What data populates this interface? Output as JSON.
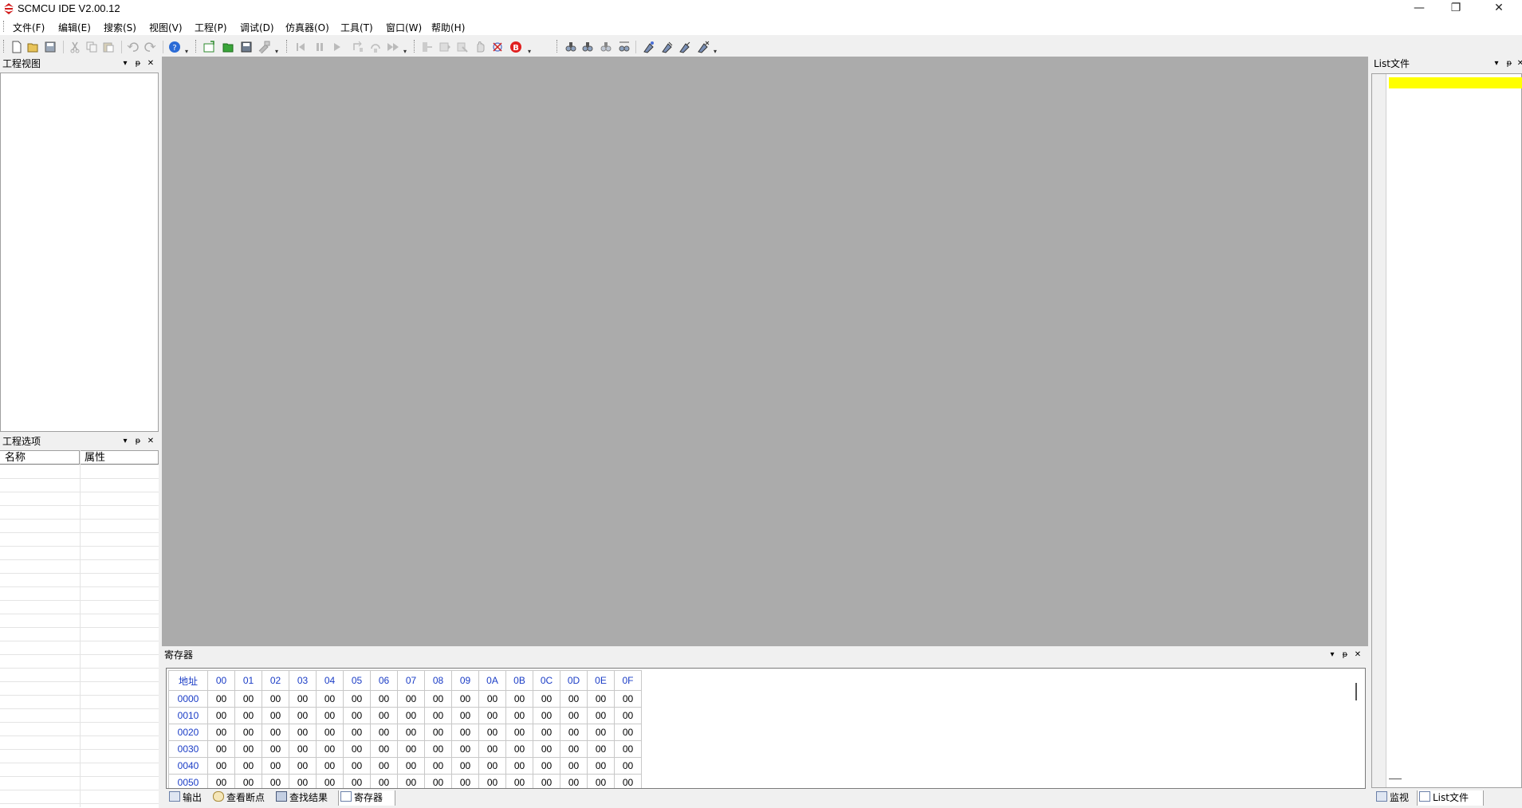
{
  "window": {
    "title": "SCMCU IDE V2.00.12",
    "minimize_glyph": "—",
    "restore_glyph": "❐",
    "close_glyph": "✕"
  },
  "menu": [
    {
      "label": "文件(F)"
    },
    {
      "label": "编辑(E)"
    },
    {
      "label": "搜索(S)"
    },
    {
      "label": "视图(V)"
    },
    {
      "label": "工程(P)"
    },
    {
      "label": "调试(D)"
    },
    {
      "label": "仿真器(O)"
    },
    {
      "label": "工具(T)"
    },
    {
      "label": "窗口(W)"
    },
    {
      "label": "帮助(H)"
    }
  ],
  "toolbar_icons": [
    "new-file-icon",
    "open-file-icon",
    "save-icon",
    "cut-icon",
    "copy-icon",
    "paste-icon",
    "undo-icon",
    "redo-icon",
    "help-icon",
    "new-project-icon",
    "open-project-icon",
    "save-project-icon",
    "build-icon",
    "reset-icon",
    "pause-icon",
    "run-icon",
    "step-into-icon",
    "step-over-icon",
    "fast-run-icon",
    "step-out-icon",
    "run-to-cursor-icon",
    "set-pc-icon",
    "stop-icon",
    "clear-breakpoints-icon",
    "breakpoint-icon",
    "find-icon",
    "find-next-icon",
    "find-prev-icon",
    "replace-icon",
    "bookmark-toggle-icon",
    "bookmark-next-icon",
    "bookmark-prev-icon",
    "bookmark-clear-icon"
  ],
  "panels": {
    "project_view": {
      "title": "工程视图"
    },
    "project_options": {
      "title": "工程选项",
      "col_name": "名称",
      "col_attr": "属性"
    },
    "register": {
      "title": "寄存器"
    },
    "list_file": {
      "title": "List文件"
    },
    "header_controls": {
      "dropdown": "▾",
      "pin": "ᵽ",
      "close": "✕"
    }
  },
  "register_table": {
    "address_header": "地址",
    "columns": [
      "00",
      "01",
      "02",
      "03",
      "04",
      "05",
      "06",
      "07",
      "08",
      "09",
      "0A",
      "0B",
      "0C",
      "0D",
      "0E",
      "0F"
    ],
    "rows": [
      {
        "addr": "0000",
        "values": [
          "00",
          "00",
          "00",
          "00",
          "00",
          "00",
          "00",
          "00",
          "00",
          "00",
          "00",
          "00",
          "00",
          "00",
          "00",
          "00"
        ]
      },
      {
        "addr": "0010",
        "values": [
          "00",
          "00",
          "00",
          "00",
          "00",
          "00",
          "00",
          "00",
          "00",
          "00",
          "00",
          "00",
          "00",
          "00",
          "00",
          "00"
        ]
      },
      {
        "addr": "0020",
        "values": [
          "00",
          "00",
          "00",
          "00",
          "00",
          "00",
          "00",
          "00",
          "00",
          "00",
          "00",
          "00",
          "00",
          "00",
          "00",
          "00"
        ]
      },
      {
        "addr": "0030",
        "values": [
          "00",
          "00",
          "00",
          "00",
          "00",
          "00",
          "00",
          "00",
          "00",
          "00",
          "00",
          "00",
          "00",
          "00",
          "00",
          "00"
        ]
      },
      {
        "addr": "0040",
        "values": [
          "00",
          "00",
          "00",
          "00",
          "00",
          "00",
          "00",
          "00",
          "00",
          "00",
          "00",
          "00",
          "00",
          "00",
          "00",
          "00"
        ]
      },
      {
        "addr": "0050",
        "values": [
          "00",
          "00",
          "00",
          "00",
          "00",
          "00",
          "00",
          "00",
          "00",
          "00",
          "00",
          "00",
          "00",
          "00",
          "00",
          "00"
        ]
      }
    ]
  },
  "bottom_tabs": [
    {
      "label": "输出",
      "icon": "output-icon"
    },
    {
      "label": "查看断点",
      "icon": "breakpoints-icon"
    },
    {
      "label": "查找结果",
      "icon": "find-results-icon"
    },
    {
      "label": "寄存器",
      "icon": "register-icon",
      "active": true
    }
  ],
  "right_tabs": [
    {
      "label": "监视",
      "icon": "watch-icon"
    },
    {
      "label": "List文件",
      "icon": "list-file-icon",
      "active": true
    }
  ],
  "colors": {
    "editor_bg": "#ababab",
    "list_highlight": "#ffff00",
    "register_text": "#1a3cc6",
    "logo_red": "#d11a1a"
  }
}
